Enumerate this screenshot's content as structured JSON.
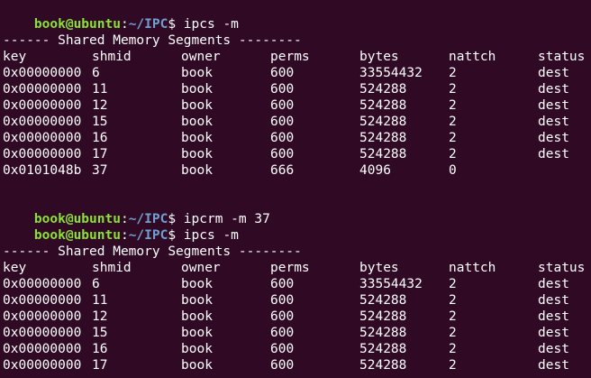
{
  "prompt": {
    "user_host": "book@ubuntu",
    "colon": ":",
    "path": "~/IPC",
    "dollar": "$"
  },
  "commands": {
    "first": " ipcs -m",
    "remove": " ipcrm -m 37",
    "second": " ipcs -m"
  },
  "section_title": "------ Shared Memory Segments --------",
  "columns": [
    "key",
    "shmid",
    "owner",
    "perms",
    "bytes",
    "nattch",
    "status"
  ],
  "table_before": [
    [
      "0x00000000",
      "6",
      "book",
      "600",
      "33554432",
      "2",
      "dest"
    ],
    [
      "0x00000000",
      "11",
      "book",
      "600",
      "524288",
      "2",
      "dest"
    ],
    [
      "0x00000000",
      "12",
      "book",
      "600",
      "524288",
      "2",
      "dest"
    ],
    [
      "0x00000000",
      "15",
      "book",
      "600",
      "524288",
      "2",
      "dest"
    ],
    [
      "0x00000000",
      "16",
      "book",
      "600",
      "524288",
      "2",
      "dest"
    ],
    [
      "0x00000000",
      "17",
      "book",
      "600",
      "524288",
      "2",
      "dest"
    ],
    [
      "0x0101048b",
      "37",
      "book",
      "666",
      "4096",
      "0",
      ""
    ]
  ],
  "table_after": [
    [
      "0x00000000",
      "6",
      "book",
      "600",
      "33554432",
      "2",
      "dest"
    ],
    [
      "0x00000000",
      "11",
      "book",
      "600",
      "524288",
      "2",
      "dest"
    ],
    [
      "0x00000000",
      "12",
      "book",
      "600",
      "524288",
      "2",
      "dest"
    ],
    [
      "0x00000000",
      "15",
      "book",
      "600",
      "524288",
      "2",
      "dest"
    ],
    [
      "0x00000000",
      "16",
      "book",
      "600",
      "524288",
      "2",
      "dest"
    ],
    [
      "0x00000000",
      "17",
      "book",
      "600",
      "524288",
      "2",
      "dest"
    ]
  ],
  "colors": {
    "background": "#300a24",
    "text": "#ffffff",
    "user_host": "#8ae234",
    "path": "#729fcf"
  }
}
